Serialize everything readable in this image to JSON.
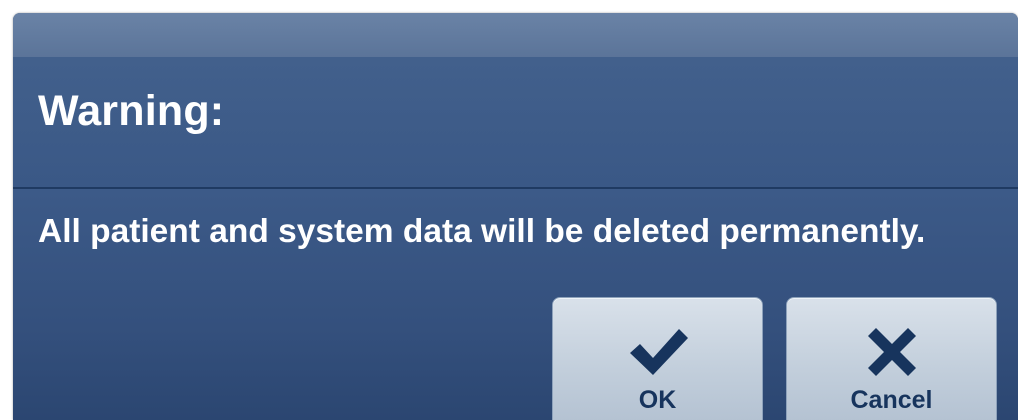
{
  "dialog": {
    "title": "Warning:",
    "message": "All patient and system data will be deleted permanently.",
    "buttons": {
      "ok": {
        "label": "OK",
        "icon": "checkmark-icon"
      },
      "cancel": {
        "label": "Cancel",
        "icon": "x-icon"
      }
    }
  },
  "colors": {
    "title_strip": "#5b7499",
    "header_bg": "#3f5d8a",
    "body_bg": "#34507d",
    "text": "#ffffff",
    "button_bg": "#c9d4e0",
    "button_text": "#17345d",
    "icon": "#17345d"
  }
}
